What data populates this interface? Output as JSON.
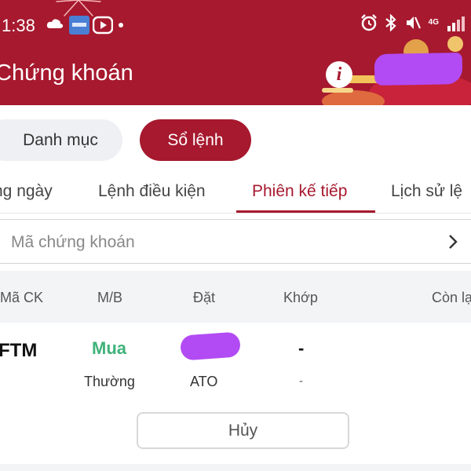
{
  "status_bar": {
    "time": "1:38",
    "network": "4G",
    "icons": [
      "cloud-icon",
      "app-icon",
      "youtube-icon",
      "alarm-icon",
      "bluetooth-icon",
      "mute-icon",
      "signal-icon"
    ]
  },
  "header": {
    "title": "Chứng khoán",
    "info_icon": "i",
    "background_color": "#a6192e"
  },
  "segments": {
    "inactive_label": "Danh mục",
    "active_label": "Sổ lệnh"
  },
  "tabs": [
    {
      "label": "ng ngày",
      "active": false
    },
    {
      "label": "Lệnh điều kiện",
      "active": false
    },
    {
      "label": "Phiên kế tiếp",
      "active": true
    },
    {
      "label": "Lịch sử lệ",
      "active": false
    }
  ],
  "search": {
    "placeholder": "Mã chứng khoán"
  },
  "table": {
    "headers": [
      "Mã CK",
      "M/B",
      "Đặt",
      "Khớp",
      "Còn lạ"
    ],
    "rows": [
      {
        "symbol": "FTM",
        "side": "Mua",
        "order_type": "Thường",
        "session": "ATO",
        "matched": "-",
        "matched_sub": "-",
        "cancel_label": "Hủy"
      }
    ]
  },
  "colors": {
    "accent": "#a6192e",
    "buy_green": "#3fb27a",
    "redaction": "#b24bf3"
  }
}
